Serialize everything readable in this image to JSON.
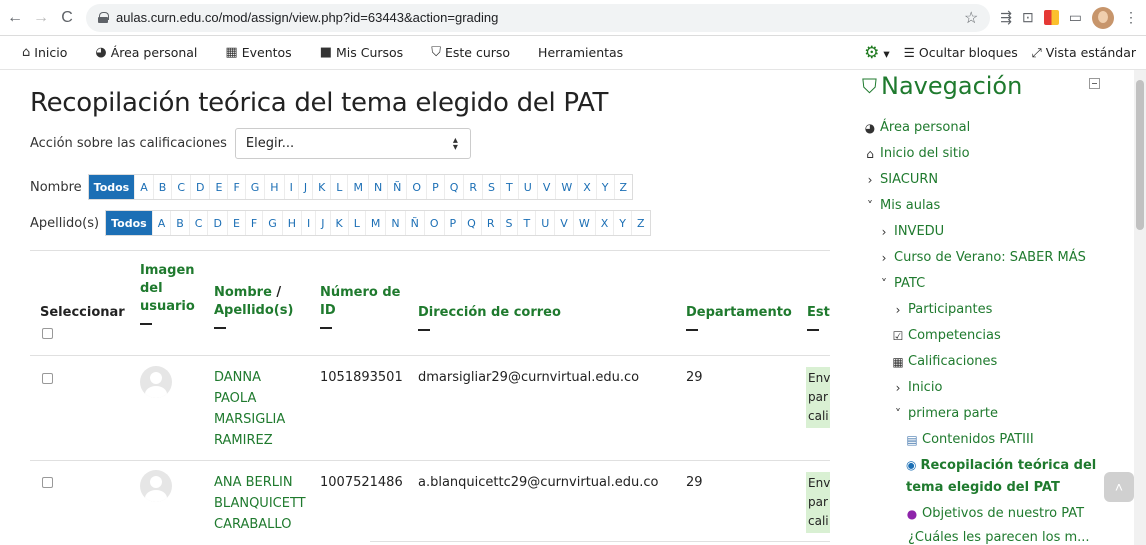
{
  "browser": {
    "url": "aulas.curn.edu.co/mod/assign/view.php?id=63443&action=grading"
  },
  "navbar": {
    "inicio": "Inicio",
    "area_personal": "Área personal",
    "eventos": "Eventos",
    "mis_cursos": "Mis Cursos",
    "este_curso": "Este curso",
    "herramientas": "Herramientas",
    "ocultar_bloques": "Ocultar bloques",
    "vista_estandar": "Vista estándar"
  },
  "page": {
    "title": "Recopilación teórica del tema elegido del PAT",
    "action_label": "Acción sobre las calificaciones",
    "action_select": "Elegir..."
  },
  "filters": {
    "nombre_label": "Nombre",
    "apellido_label": "Apellido(s)",
    "todos": "Todos",
    "letters": [
      "A",
      "B",
      "C",
      "D",
      "E",
      "F",
      "G",
      "H",
      "I",
      "J",
      "K",
      "L",
      "M",
      "N",
      "Ñ",
      "O",
      "P",
      "Q",
      "R",
      "S",
      "T",
      "U",
      "V",
      "W",
      "X",
      "Y",
      "Z"
    ]
  },
  "table": {
    "headers": {
      "seleccionar": "Seleccionar",
      "imagen_l1": "Imagen",
      "imagen_l2": "del",
      "imagen_l3": "usuario",
      "nombre": "Nombre",
      "apellido": "Apellido(s)",
      "numero_l1": "Número de",
      "numero_l2": "ID",
      "correo": "Dirección de correo",
      "departamento": "Departamento",
      "estado": "Est"
    },
    "rows": [
      {
        "name_lines": [
          "DANNA",
          "PAOLA",
          "MARSIGLIA",
          "RAMIREZ"
        ],
        "id": "1051893501",
        "email": "dmarsigliar29@curnvirtual.edu.co",
        "dept": "29",
        "status_lines": [
          "Env",
          "par",
          "cali"
        ]
      },
      {
        "name_lines": [
          "ANA BERLIN",
          "BLANQUICETT",
          "CARABALLO"
        ],
        "id": "1007521486",
        "email": "a.blanquicettc29@curnvirtual.edu.co",
        "dept": "29",
        "status_lines": [
          "Env",
          "par",
          "cali"
        ]
      }
    ]
  },
  "nav_block": {
    "title": "Navegación",
    "items": {
      "area_personal": "Área personal",
      "inicio_sitio": "Inicio del sitio",
      "siacurn": "SIACURN",
      "mis_aulas": "Mis aulas",
      "invedu": "INVEDU",
      "curso_verano": "Curso de Verano: SABER MÁS",
      "patc": "PATC",
      "participantes": "Participantes",
      "competencias": "Competencias",
      "calificaciones": "Calificaciones",
      "inicio": "Inicio",
      "primera_parte": "primera parte",
      "contenidos": "Contenidos PATIII",
      "recopilacion_l1": "Recopilación teórica del",
      "recopilacion_l2": "tema elegido del PAT",
      "objetivos": "Objetivos de nuestro PAT",
      "cuales": "¿Cuáles les parecen los m..."
    }
  }
}
